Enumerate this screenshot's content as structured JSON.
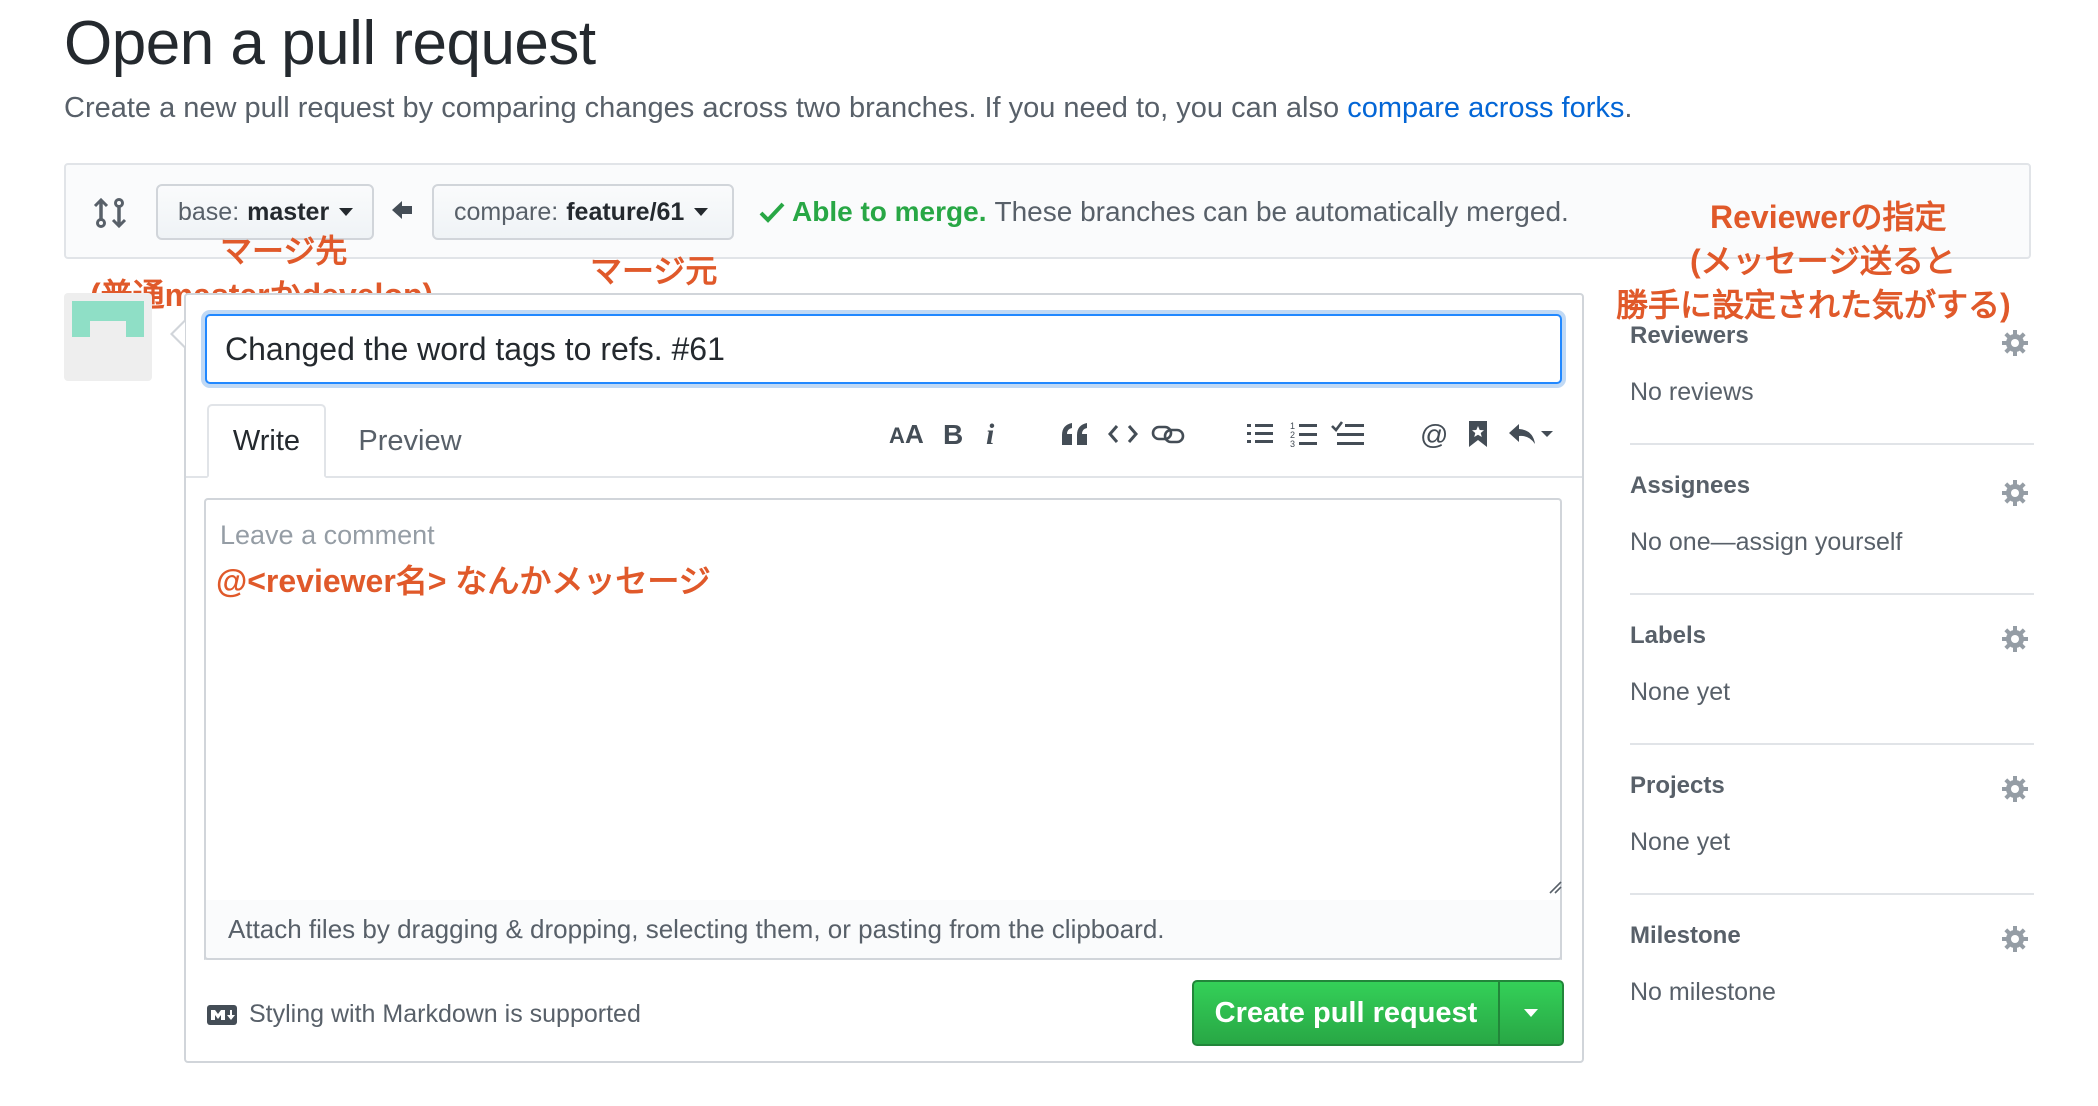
{
  "header": {
    "title": "Open a pull request",
    "subtitle": "Create a new pull request by comparing changes across two branches. If you need to, you can also ",
    "subtitle_link": "compare across forks",
    "subtitle_end": "."
  },
  "range": {
    "base_key": "base:",
    "base_value": "master",
    "compare_key": "compare:",
    "compare_value": "feature/61",
    "merge_ok": "Able to merge.",
    "merge_text": "These branches can be automatically merged."
  },
  "annotations": {
    "base_note_1": "マージ先",
    "base_note_2": "(普通masterかdevelop)",
    "compare_note": "マージ元",
    "reviewer_note_1": "Reviewerの指定",
    "reviewer_note_2": "(メッセージ送ると",
    "reviewer_note_3": "勝手に設定された気がする)",
    "comment_note": "@<reviewer名> なんかメッセージ"
  },
  "editor": {
    "title_value": "Changed the word tags to refs. #61",
    "tab_write": "Write",
    "tab_preview": "Preview",
    "toolbar": [
      "header-icon",
      "bold-icon",
      "italic-icon",
      "quote-icon",
      "code-icon",
      "link-icon",
      "unordered-list-icon",
      "ordered-list-icon",
      "task-list-icon",
      "mention-icon",
      "saved-reply-icon",
      "reply-icon"
    ],
    "comment_placeholder": "Leave a comment",
    "attach_text": "Attach files by dragging & dropping, selecting them, or pasting from the clipboard.",
    "markdown_note": "Styling with Markdown is supported",
    "create_button": "Create pull request"
  },
  "sidebar": {
    "sections": [
      {
        "title": "Reviewers",
        "value": "No reviews"
      },
      {
        "title": "Assignees",
        "value": "No one—assign yourself"
      },
      {
        "title": "Labels",
        "value": "None yet"
      },
      {
        "title": "Projects",
        "value": "None yet"
      },
      {
        "title": "Milestone",
        "value": "No milestone"
      }
    ]
  },
  "colors": {
    "link": "#0366d6",
    "success": "#28a745",
    "annotation": "#e0592a",
    "focus": "#2188ff"
  }
}
